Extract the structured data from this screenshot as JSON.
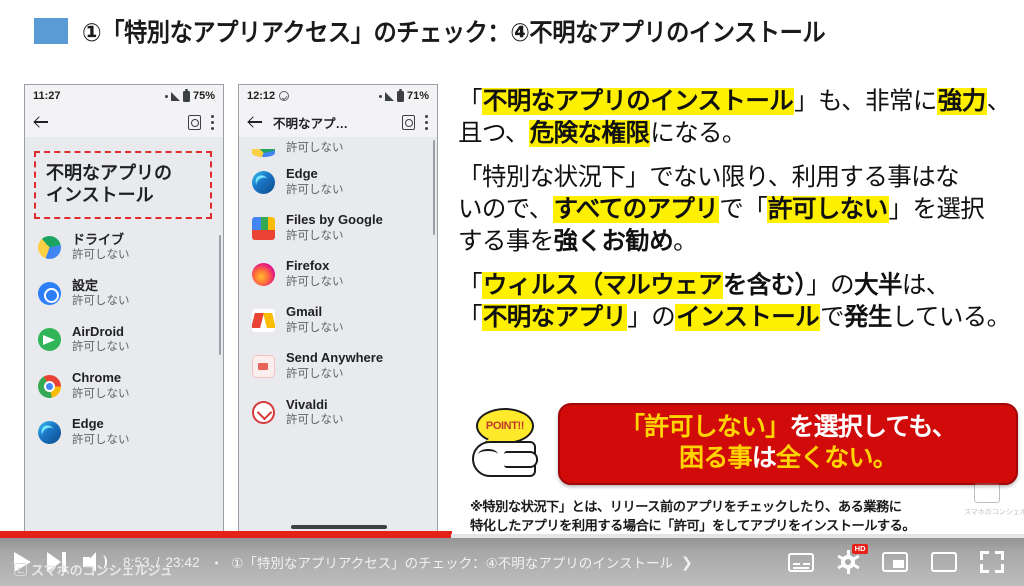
{
  "header": {
    "title": "①「特別なアプリアクセス」のチェック：④不明なアプリのインストール"
  },
  "phone_left": {
    "status": {
      "time": "11:27",
      "battery": "75%"
    },
    "appbar": {
      "back": "back-arrow",
      "doc": "document-icon",
      "menu": "overflow-menu"
    },
    "highlight_box": {
      "line1": "不明なアプリの",
      "line2": "インストール"
    },
    "apps": [
      {
        "name": "ドライブ",
        "status": "許可しない",
        "icon": "drive"
      },
      {
        "name": "設定",
        "status": "許可しない",
        "icon": "settings"
      },
      {
        "name": "AirDroid",
        "status": "許可しない",
        "icon": "airdroid"
      },
      {
        "name": "Chrome",
        "status": "許可しない",
        "icon": "chrome"
      },
      {
        "name": "Edge",
        "status": "許可しない",
        "icon": "edge"
      }
    ]
  },
  "phone_right": {
    "status": {
      "time": "12:12",
      "battery": "71%"
    },
    "appbar": {
      "title": "不明なアプ…"
    },
    "partial_top_status": "許可しない",
    "apps": [
      {
        "name": "Edge",
        "status": "許可しない",
        "icon": "edge"
      },
      {
        "name": "Files by Google",
        "status": "許可しない",
        "icon": "files"
      },
      {
        "name": "Firefox",
        "status": "許可しない",
        "icon": "firefox"
      },
      {
        "name": "Gmail",
        "status": "許可しない",
        "icon": "gmail"
      },
      {
        "name": "Send Anywhere",
        "status": "許可しない",
        "icon": "send"
      },
      {
        "name": "Vivaldi",
        "status": "許可しない",
        "icon": "vivaldi"
      }
    ]
  },
  "panel": {
    "p1": {
      "l1": {
        "a": "「",
        "hl1": "不明なアプリのインストール",
        "b": "」も、非常に",
        "hl2": "強力",
        "c": "、"
      },
      "l2": {
        "a": "且つ、",
        "hl1": "危険な権限",
        "b": "になる。"
      }
    },
    "p2": {
      "l1": "「特別な状況下」でない限り、利用する事はな",
      "l2": {
        "a": "いので、",
        "hl1": "すべてのアプリ",
        "b": "で「",
        "hl2": "許可しない",
        "c": "」を選択"
      },
      "l3": {
        "a": "する事を",
        "b": "強くお勧め",
        "c": "。"
      }
    },
    "p3": {
      "l1": {
        "a": "「",
        "hl1": "ウィルス（マルウェア",
        "b": "を含む）",
        "c": "」の",
        "d": "大半",
        "e": "は、"
      },
      "l2": {
        "a": "「",
        "hl1": "不明なアプリ",
        "b": "」の",
        "hl2": "インストール",
        "c": "で",
        "d": "発生",
        "e": "している。"
      }
    }
  },
  "point": {
    "badge": "POINT!!",
    "line1_a": "「許可しない」",
    "line1_b": "を選択しても、",
    "line2_a": "困る事",
    "line2_b": "は",
    "line2_c": "全くない。"
  },
  "note": {
    "l1": "※特別な状況下」とは、リリース前のアプリをチェックしたり、ある業務に",
    "l2": "特化したアプリを利用する場合に「許可」をしてアプリをインストールする。"
  },
  "watermark": {
    "text": "スマホのコンシェルジュ"
  },
  "player": {
    "current_time": "8:53",
    "total_time": "23:42",
    "separator": "/",
    "dot": "・",
    "chapter": "①「特別なアプリアクセス」のチェック：④不明なアプリのインストール",
    "chevron": "❯",
    "brand": "スマホのコンシェルジュ",
    "hd_badge": "HD",
    "progress_percent": 44,
    "buffer_percent": 100,
    "accent_color": "#e62117",
    "icons": {
      "play": "play-icon",
      "next": "next-video-icon",
      "volume": "volume-icon",
      "captions": "captions-icon",
      "settings": "settings-gear-icon",
      "miniplayer": "miniplayer-icon",
      "theater": "theater-mode-icon",
      "fullscreen": "fullscreen-icon"
    }
  }
}
